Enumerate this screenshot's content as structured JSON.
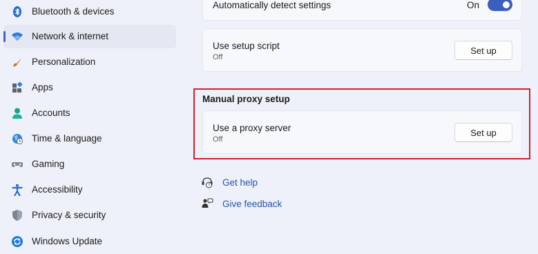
{
  "sidebar": {
    "items": [
      {
        "label": "Bluetooth & devices",
        "icon": "bluetooth-icon"
      },
      {
        "label": "Network & internet",
        "icon": "wifi-icon",
        "active": true
      },
      {
        "label": "Personalization",
        "icon": "brush-icon"
      },
      {
        "label": "Apps",
        "icon": "apps-icon"
      },
      {
        "label": "Accounts",
        "icon": "person-icon"
      },
      {
        "label": "Time & language",
        "icon": "globe-clock-icon"
      },
      {
        "label": "Gaming",
        "icon": "gamepad-icon"
      },
      {
        "label": "Accessibility",
        "icon": "accessibility-icon"
      },
      {
        "label": "Privacy & security",
        "icon": "shield-icon"
      },
      {
        "label": "Windows Update",
        "icon": "update-icon"
      }
    ]
  },
  "auto_detect": {
    "title": "Automatically detect settings",
    "toggle_state": "On",
    "toggle_on": true
  },
  "setup_script": {
    "title": "Use setup script",
    "status": "Off",
    "button": "Set up"
  },
  "manual_proxy": {
    "heading": "Manual proxy setup",
    "title": "Use a proxy server",
    "status": "Off",
    "button": "Set up"
  },
  "links": {
    "help": "Get help",
    "feedback": "Give feedback"
  },
  "colors": {
    "accent": "#3a5fbd",
    "highlight": "#d21f2b",
    "link": "#2455b0"
  }
}
